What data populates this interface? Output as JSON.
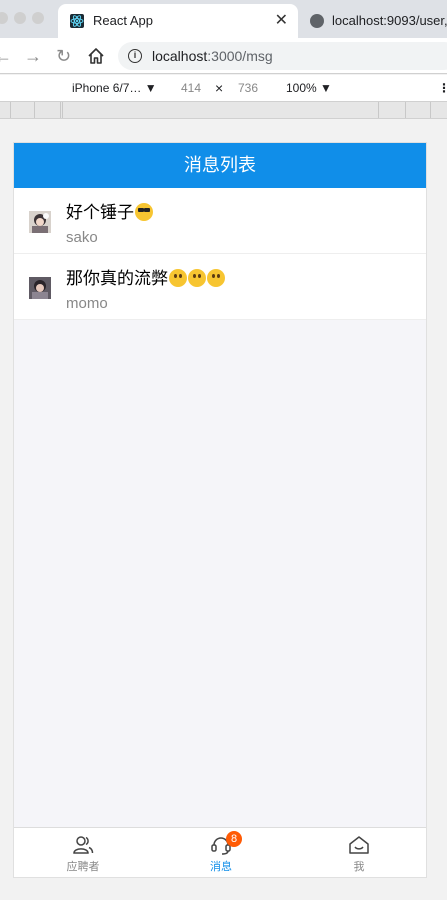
{
  "browser": {
    "active_tab_title": "React App",
    "inactive_tab_title": "localhost:9093/user,",
    "url_host": "localhost",
    "url_rest": ":3000/msg"
  },
  "device_toolbar": {
    "device": "iPhone 6/7… ▼",
    "width": "414",
    "times": "×",
    "height": "736",
    "zoom": "100% ▼"
  },
  "app": {
    "title": "消息列表",
    "messages": [
      {
        "text": "好个锤子",
        "emojis": [
          "cool"
        ],
        "sender": "sako"
      },
      {
        "text": "那你真的流弊",
        "emojis": [
          "grin",
          "smile",
          "laugh"
        ],
        "sender": "momo"
      }
    ],
    "tabbar": [
      {
        "label": "应聘者",
        "icon": "users-icon",
        "active": false
      },
      {
        "label": "消息",
        "icon": "chat-icon",
        "active": true,
        "badge": "8"
      },
      {
        "label": "我",
        "icon": "home-icon",
        "active": false
      }
    ]
  },
  "colors": {
    "primary": "#108ee9",
    "badge": "#ff5b05",
    "background": "#f5f5f9"
  }
}
